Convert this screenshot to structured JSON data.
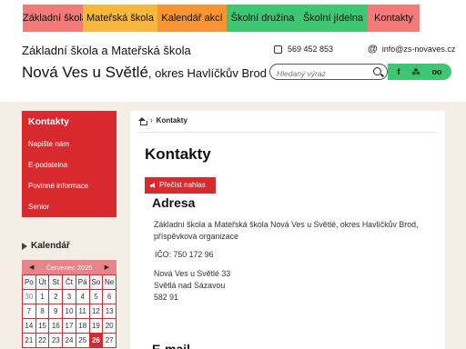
{
  "nav": [
    {
      "label": "Základní škola",
      "color": "#f47a7a"
    },
    {
      "label": "Mateřská škola",
      "color": "#f7b73c"
    },
    {
      "label": "Kalendář akcí",
      "color": "#f89433"
    },
    {
      "label": "Školní družina",
      "color": "#3fc672"
    },
    {
      "label": "Školní jídelna",
      "color": "#3fc672"
    },
    {
      "label": "Kontakty",
      "color": "#f47a7a"
    }
  ],
  "header": {
    "subtitle": "Základní škola a Mateřská škola",
    "title_main": "Nová Ves u Světlé",
    "title_suffix": ", okres Havlíčkův Brod",
    "phone": "569 452 853",
    "email": "info@zs-novaves.cz",
    "search_placeholder": "Hledaný výraz",
    "social": [
      "f",
      "⁂",
      "oo"
    ]
  },
  "sidebar": {
    "heading": "Kontakty",
    "items": [
      "Napište nám",
      "E-podatelna",
      "Povinné informace",
      "Senior"
    ]
  },
  "calendar": {
    "title": "Kalendář",
    "month": "Červenec 2025",
    "prev": "◀",
    "next": "▶",
    "weekdays": [
      "Po",
      "Út",
      "St",
      "Čt",
      "Pá",
      "So",
      "Ne"
    ],
    "rows": [
      [
        "30",
        "1",
        "2",
        "3",
        "4",
        "5",
        "6"
      ],
      [
        "7",
        "8",
        "9",
        "10",
        "11",
        "12",
        "13"
      ],
      [
        "14",
        "15",
        "16",
        "17",
        "18",
        "19",
        "20"
      ],
      [
        "21",
        "22",
        "23",
        "24",
        "25",
        "26",
        "27"
      ]
    ],
    "today": "26",
    "accent": "#d8292f"
  },
  "content": {
    "breadcrumb": "Kontakty",
    "heading": "Kontakty",
    "read_aloud": "Přečíst nahlas",
    "section": "Adresa",
    "org": "Základní škola a Mateřská škola Nová Ves u Světlé, okres Havlíčkův Brod, příspěvková organizace",
    "ico": "IČO: 750 172 96",
    "address": [
      "Nová Ves u Světlé 33",
      "Světlá nad Sázavou",
      "582 91"
    ],
    "next_section": "E-mail"
  }
}
